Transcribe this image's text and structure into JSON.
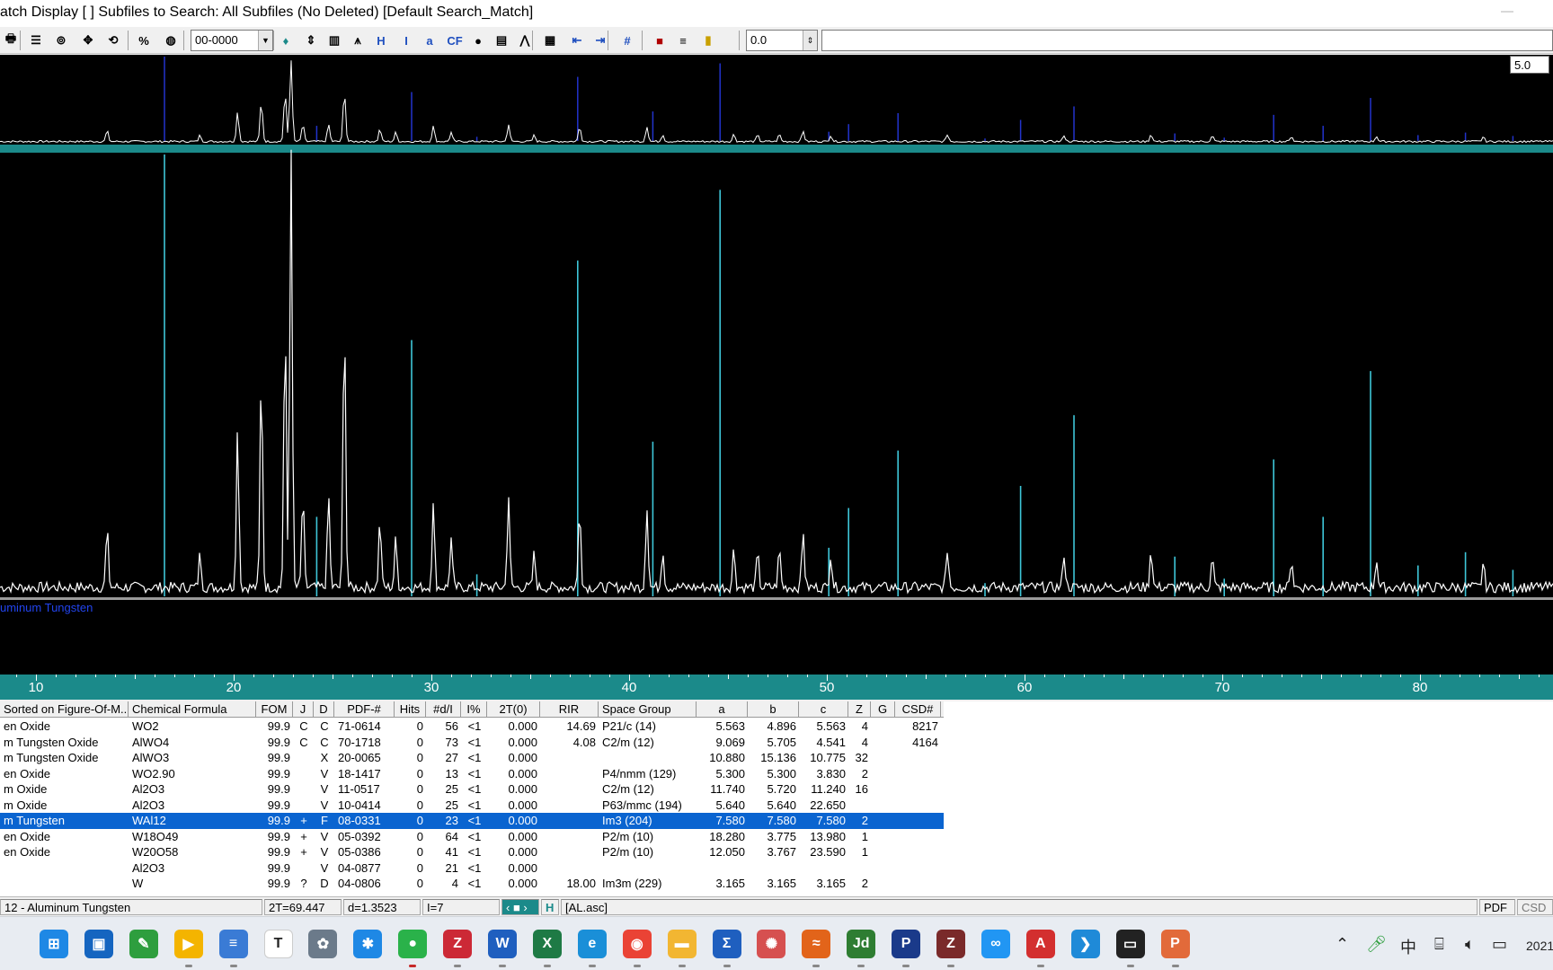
{
  "window": {
    "title": "atch Display [ ] Subfiles to Search: All Subfiles (No Deleted) [Default Search_Match]"
  },
  "toolbar": {
    "pdf_combo_value": "00-0000",
    "offset_value": "0.0",
    "icons": [
      "print-icon",
      "list-icon",
      "pattern-icon",
      "move-icon",
      "rotate-icon",
      "percent-icon",
      "globe-icon",
      "drop-icon",
      "up-down-icon",
      "bar-icon",
      "peak-icon",
      "hkl-icon",
      "ix-icon",
      "abc-icon",
      "cf-icon",
      "sphere-icon",
      "histogram-icon",
      "overlay-icon",
      "grid-icon",
      "left-arrows-icon",
      "right-arrows-icon",
      "hash-icon",
      "red-box-icon",
      "stack-icon",
      "yellow-bar-icon"
    ]
  },
  "plot": {
    "scale_value": "5.0",
    "phase_label": "uminum Tungsten",
    "colors": {
      "background": "#000000",
      "trace": "#ffffff",
      "reference_lines": "#3ec6d8",
      "axis": "#1b8a8a"
    }
  },
  "axis": {
    "ticks": [
      "10",
      "20",
      "30",
      "40",
      "50",
      "60",
      "70",
      "80"
    ]
  },
  "table": {
    "headers": [
      "Sorted on Figure-Of-M...",
      "Chemical Formula",
      "FOM",
      "J",
      "D",
      "PDF-#",
      "Hits",
      "#d/I",
      "I%",
      "2T(0)",
      "RIR",
      "Space Group",
      "a",
      "b",
      "c",
      "Z",
      "G",
      "CSD#"
    ],
    "rows": [
      [
        "en Oxide",
        "WO2",
        "99.9",
        "C",
        "C",
        "71-0614",
        "0",
        "56",
        "<1",
        "0.000",
        "14.69",
        "P21/c (14)",
        "5.563",
        "4.896",
        "5.563",
        "4",
        "",
        "8217"
      ],
      [
        "m Tungsten Oxide",
        "AlWO4",
        "99.9",
        "C",
        "C",
        "70-1718",
        "0",
        "73",
        "<1",
        "0.000",
        "4.08",
        "C2/m (12)",
        "9.069",
        "5.705",
        "4.541",
        "4",
        "",
        "4164"
      ],
      [
        "m Tungsten Oxide",
        "AlWO3",
        "99.9",
        "",
        "X",
        "20-0065",
        "0",
        "27",
        "<1",
        "0.000",
        "",
        "",
        "10.880",
        "15.136",
        "10.775",
        "32",
        "",
        ""
      ],
      [
        "en Oxide",
        "WO2.90",
        "99.9",
        "",
        "V",
        "18-1417",
        "0",
        "13",
        "<1",
        "0.000",
        "",
        "P4/nmm (129)",
        "5.300",
        "5.300",
        "3.830",
        "2",
        "",
        ""
      ],
      [
        "m Oxide",
        "Al2O3",
        "99.9",
        "",
        "V",
        "11-0517",
        "0",
        "25",
        "<1",
        "0.000",
        "",
        "C2/m (12)",
        "11.740",
        "5.720",
        "11.240",
        "16",
        "",
        ""
      ],
      [
        "m Oxide",
        "Al2O3",
        "99.9",
        "",
        "V",
        "10-0414",
        "0",
        "25",
        "<1",
        "0.000",
        "",
        "P63/mmc (194)",
        "5.640",
        "5.640",
        "22.650",
        "",
        "",
        ""
      ],
      [
        "m Tungsten",
        "WAl12",
        "99.9",
        "+",
        "F",
        "08-0331",
        "0",
        "23",
        "<1",
        "0.000",
        "",
        "Im3 (204)",
        "7.580",
        "7.580",
        "7.580",
        "2",
        "",
        ""
      ],
      [
        "en Oxide",
        "W18O49",
        "99.9",
        "+",
        "V",
        "05-0392",
        "0",
        "64",
        "<1",
        "0.000",
        "",
        "P2/m (10)",
        "18.280",
        "3.775",
        "13.980",
        "1",
        "",
        ""
      ],
      [
        "en Oxide",
        "W20O58",
        "99.9",
        "+",
        "V",
        "05-0386",
        "0",
        "41",
        "<1",
        "0.000",
        "",
        "P2/m (10)",
        "12.050",
        "3.767",
        "23.590",
        "1",
        "",
        ""
      ],
      [
        "",
        "Al2O3",
        "99.9",
        "",
        "V",
        "04-0877",
        "0",
        "21",
        "<1",
        "0.000",
        "",
        "",
        "",
        "",
        "",
        "",
        "",
        ""
      ],
      [
        "",
        "W",
        "99.9",
        "?",
        "D",
        "04-0806",
        "0",
        "4",
        "<1",
        "0.000",
        "18.00",
        "Im3m (229)",
        "3.165",
        "3.165",
        "3.165",
        "2",
        "",
        ""
      ]
    ],
    "selected_row": 6
  },
  "status": {
    "phase": "12 - Aluminum Tungsten",
    "two_theta": "2T=69.447",
    "d_spacing": "d=1.3523",
    "intensity": "I=7",
    "h_label": "H",
    "file": "[AL.asc]",
    "pdf_label": "PDF",
    "csd_label": "CSD"
  },
  "taskbar": {
    "apps": [
      {
        "name": "windows-start-icon",
        "glyph": "⊞",
        "color": "#1e88e5"
      },
      {
        "name": "store-icon",
        "glyph": "▣",
        "color": "#1565c0"
      },
      {
        "name": "leaf-app-icon",
        "glyph": "✎",
        "color": "#2e9e3e"
      },
      {
        "name": "player-icon",
        "glyph": "▶",
        "color": "#f4b400"
      },
      {
        "name": "notepad-icon",
        "glyph": "≡",
        "color": "#3a7bd5"
      },
      {
        "name": "typora-icon",
        "glyph": "T",
        "color": "#ffffff"
      },
      {
        "name": "photos-icon",
        "glyph": "✿",
        "color": "#6b7a8a"
      },
      {
        "name": "tencent-icon",
        "glyph": "✱",
        "color": "#1e88e5"
      },
      {
        "name": "wechat-icon",
        "glyph": "●",
        "color": "#2ab24a"
      },
      {
        "name": "zotero-icon",
        "glyph": "Z",
        "color": "#cc2936"
      },
      {
        "name": "word-icon",
        "glyph": "W",
        "color": "#1f5fbf"
      },
      {
        "name": "excel-icon",
        "glyph": "X",
        "color": "#1e7a45"
      },
      {
        "name": "edge-icon",
        "glyph": "e",
        "color": "#1a8fd8"
      },
      {
        "name": "chrome-icon",
        "glyph": "◉",
        "color": "#ea4335"
      },
      {
        "name": "folder-icon",
        "glyph": "▬",
        "color": "#f2b632"
      },
      {
        "name": "sigma-icon",
        "glyph": "Σ",
        "color": "#1f5fbf"
      },
      {
        "name": "tool-icon",
        "glyph": "✺",
        "color": "#d65050"
      },
      {
        "name": "origin-icon",
        "glyph": "≈",
        "color": "#e2641a"
      },
      {
        "name": "jade-icon",
        "glyph": "Jd",
        "color": "#2e7d32"
      },
      {
        "name": "p-app-icon",
        "glyph": "P",
        "color": "#1a3a8a"
      },
      {
        "name": "z-tool-icon",
        "glyph": "Z",
        "color": "#7a2a2a"
      },
      {
        "name": "baidu-icon",
        "glyph": "∞",
        "color": "#2196f3"
      },
      {
        "name": "acrobat-icon",
        "glyph": "A",
        "color": "#d32f2f"
      },
      {
        "name": "vscode-icon",
        "glyph": "❯",
        "color": "#1f8ad8"
      },
      {
        "name": "terminal-icon",
        "glyph": "▭",
        "color": "#222222"
      },
      {
        "name": "powerpoint-icon",
        "glyph": "P",
        "color": "#e26a3a"
      }
    ],
    "tray": {
      "ime": "中",
      "clock": "2021"
    }
  }
}
